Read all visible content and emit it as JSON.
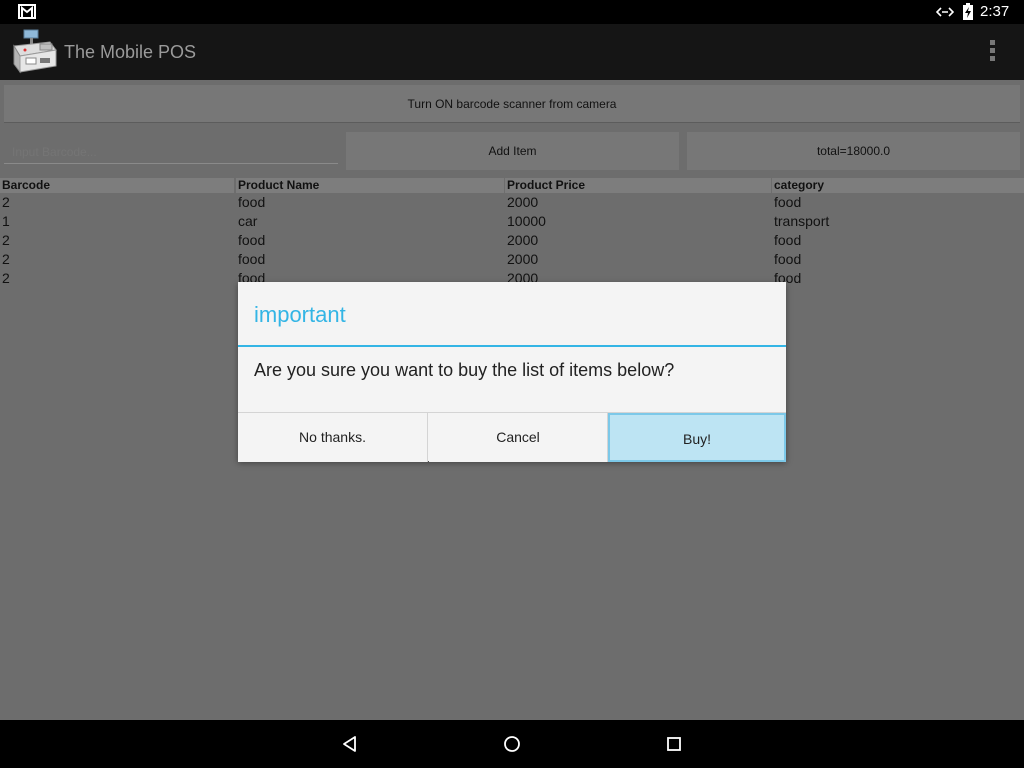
{
  "status_bar": {
    "time": "2:37",
    "notification_icon": "gmail-icon",
    "sync_icon": "sync-icon",
    "battery_icon": "battery-charging-icon"
  },
  "action_bar": {
    "title": "The Mobile POS",
    "logo_icon": "cash-register-icon",
    "menu_icon": "overflow-menu-icon"
  },
  "controls": {
    "scanner_button": "Turn ON barcode scanner from camera",
    "barcode_placeholder": "Input Barcode...",
    "add_item_button": "Add Item",
    "total_label": "total=18000.0"
  },
  "table": {
    "headers": [
      "Barcode",
      "Product Name",
      "Product Price",
      "category"
    ],
    "rows": [
      [
        "2",
        "food",
        "2000",
        "food"
      ],
      [
        "1",
        "car",
        "10000",
        "transport"
      ],
      [
        "2",
        "food",
        "2000",
        "food"
      ],
      [
        "2",
        "food",
        "2000",
        "food"
      ],
      [
        "2",
        "food",
        "2000",
        "food"
      ]
    ]
  },
  "dialog": {
    "title": "important",
    "message": "Are you sure you want to buy the list of items below?",
    "no_button": "No thanks.",
    "cancel_button": "Cancel",
    "buy_button": "Buy!"
  },
  "nav_bar": {
    "back_icon": "back-icon",
    "home_icon": "home-icon",
    "recents_icon": "recents-icon"
  },
  "colors": {
    "accent": "#33b5e5",
    "buy_highlight": "#bde4f3"
  }
}
